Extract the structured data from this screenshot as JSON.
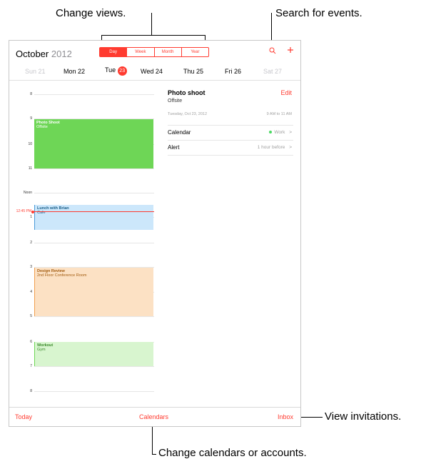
{
  "callouts": {
    "change_views": "Change views.",
    "search_events": "Search for events.",
    "view_invitations": "View invitations.",
    "change_calendars": "Change calendars or accounts."
  },
  "header": {
    "month": "October",
    "year": "2012",
    "views": [
      "Day",
      "Week",
      "Month",
      "Year"
    ],
    "search_icon": "search-icon",
    "add_icon": "plus-icon"
  },
  "days": [
    {
      "label": "Sun 21"
    },
    {
      "label": "Mon 22"
    },
    {
      "label": "Tue",
      "num": "23"
    },
    {
      "label": "Wed 24"
    },
    {
      "label": "Thu 25"
    },
    {
      "label": "Fri 26"
    },
    {
      "label": "Sat 27"
    }
  ],
  "hours": [
    "8",
    "9",
    "10",
    "11",
    "Noon",
    "1",
    "2",
    "3",
    "4",
    "5",
    "6",
    "7",
    "8"
  ],
  "now_label": "12:45 PM",
  "events": [
    {
      "title": "Photo Shoot",
      "sub": "Offsite",
      "color": "#6ed656"
    },
    {
      "title": "Lunch with Brian",
      "sub": "Cafe",
      "color": "#cce7fb"
    },
    {
      "title": "Design Review",
      "sub": "2nd Floor Conference Room",
      "color": "#fce1c4"
    },
    {
      "title": "Workout",
      "sub": "Gym",
      "color": "#d8f5cf"
    }
  ],
  "detail": {
    "title": "Photo shoot",
    "location": "Offsite",
    "edit": "Edit",
    "date": "Tuesday, Oct 23, 2012",
    "time": "9 AM to 11 AM",
    "calendar_label": "Calendar",
    "calendar_value": "Work",
    "alert_label": "Alert",
    "alert_value": "1 hour before",
    "chevron": ">"
  },
  "bottom": {
    "today": "Today",
    "calendars": "Calendars",
    "inbox": "Inbox"
  }
}
